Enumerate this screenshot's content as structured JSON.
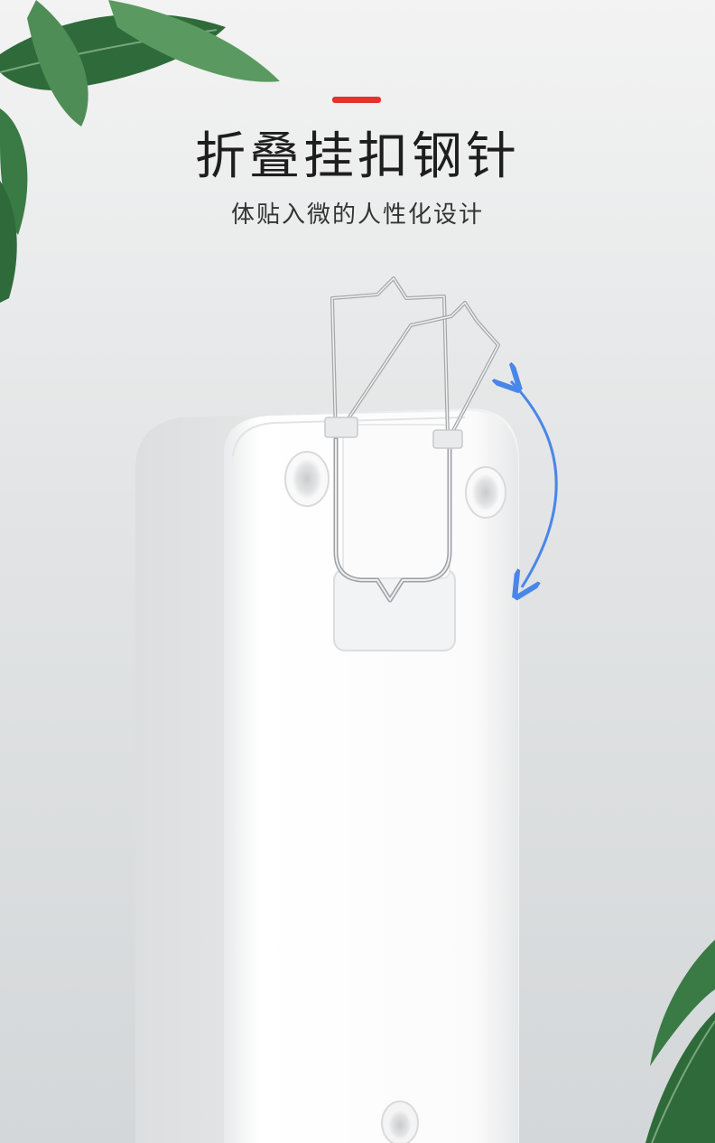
{
  "header": {
    "title": "折叠挂扣钢针",
    "subtitle": "体贴入微的人性化设计"
  },
  "colors": {
    "accent": "#e5322d",
    "arrow": "#4a86e8",
    "leaf_dark": "#2f6b3a",
    "leaf_light": "#4f8d57"
  },
  "icons": {
    "rotation_arrow": "curved-double-arrow-icon"
  }
}
